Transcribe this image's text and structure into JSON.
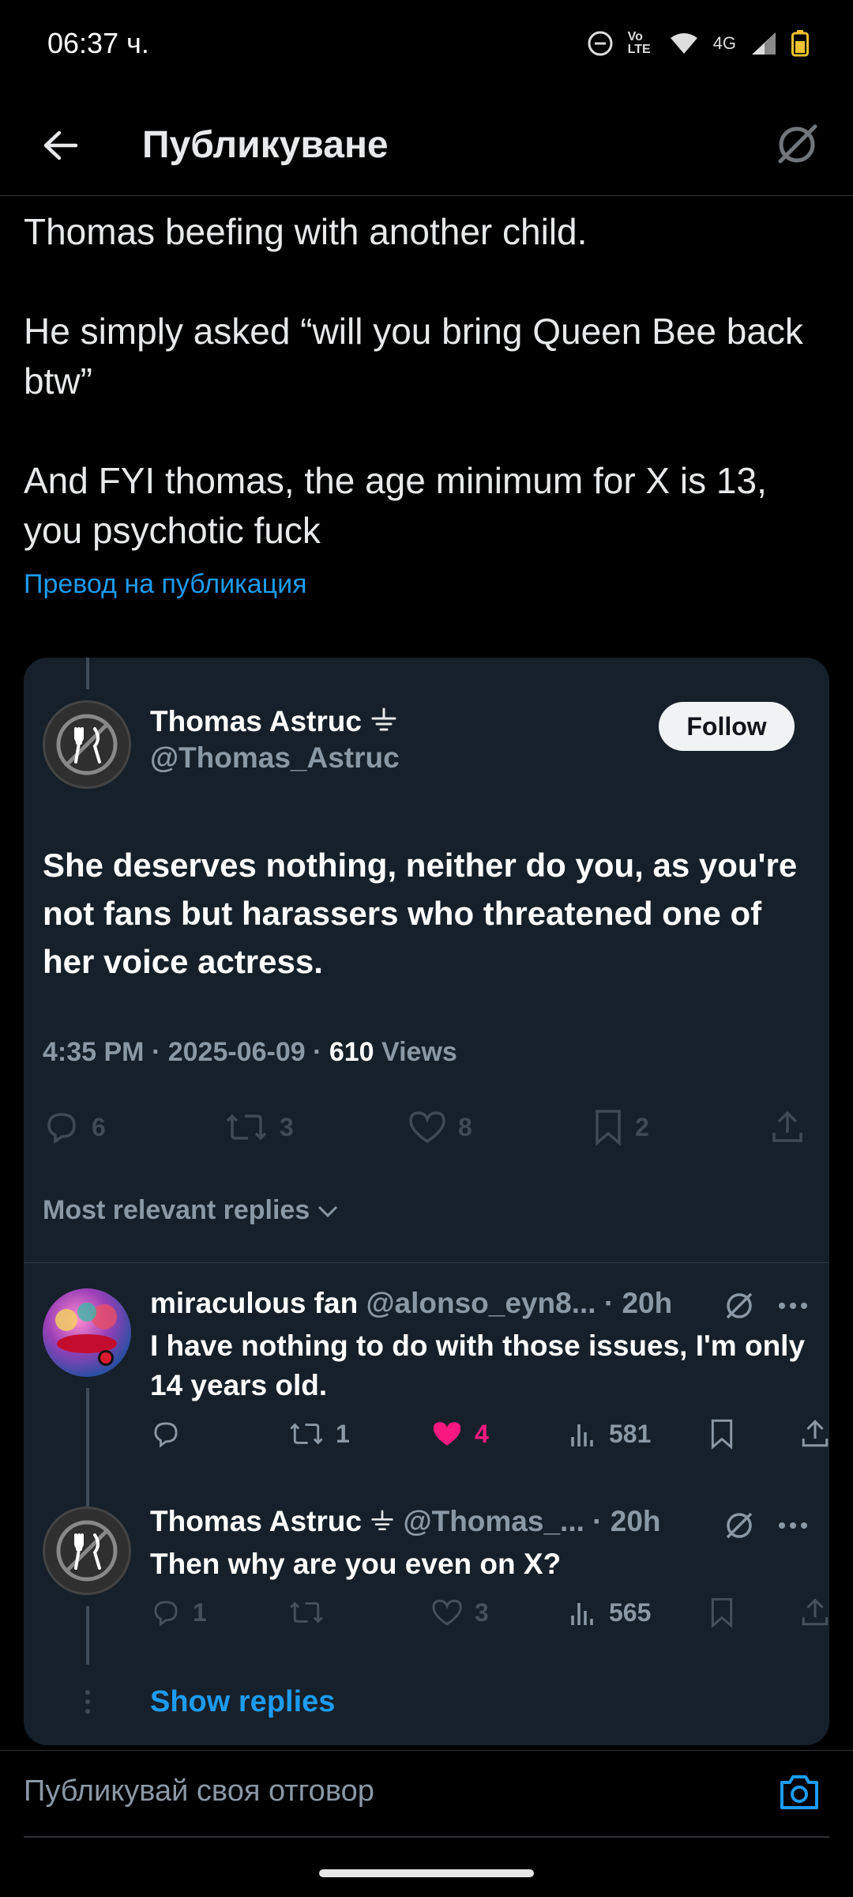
{
  "status_bar": {
    "time": "06:37 ч.",
    "network": "4G",
    "volte": "Vo LTE",
    "icons": [
      "do-not-disturb-icon",
      "volte-icon",
      "wifi-icon",
      "signal-icon",
      "battery-icon"
    ]
  },
  "header": {
    "title": "Публикуване",
    "back_icon": "arrow-left-icon",
    "right_icon": "circle-slash-icon"
  },
  "post": {
    "paragraphs": [
      "Thomas beefing with another child.",
      "He simply asked “will you bring Queen Bee back btw”",
      "And FYI thomas, the age minimum for X is 13, you psychotic fuck"
    ],
    "translate_link": "Превод на публикация"
  },
  "quoted": {
    "author_name": "Thomas Astruc",
    "author_handle": "@Thomas_Astruc",
    "follow_label": "Follow",
    "text": "She deserves nothing, neither do you, as you're not fans but harassers who threatened one of her voice actress.",
    "time": "4:35 PM",
    "date": "2025-06-09",
    "views_count": "610",
    "views_label": "Views",
    "stats": {
      "replies": "6",
      "reposts": "3",
      "likes": "8",
      "bookmarks": "2"
    },
    "sort_label": "Most relevant replies"
  },
  "replies": [
    {
      "name": "miraculous fan",
      "handle": "@alonso_eyn8...",
      "age": "20h",
      "text": "I have nothing to do with those issues, I'm only 14 years old.",
      "replies": "",
      "reposts": "1",
      "likes": "4",
      "views": "581",
      "liked": true
    },
    {
      "name": "Thomas Astruc",
      "handle": "@Thomas_...",
      "age": "20h",
      "text": "Then why are you even on X?",
      "replies": "1",
      "reposts": "",
      "likes": "3",
      "views": "565",
      "liked": false
    }
  ],
  "show_replies_label": "Show replies",
  "compose": {
    "placeholder": "Публикувай своя отговор"
  },
  "colors": {
    "accent": "#1d9bf0",
    "like": "#f91880",
    "card_bg": "#16202a",
    "muted": "#8b98a5"
  }
}
